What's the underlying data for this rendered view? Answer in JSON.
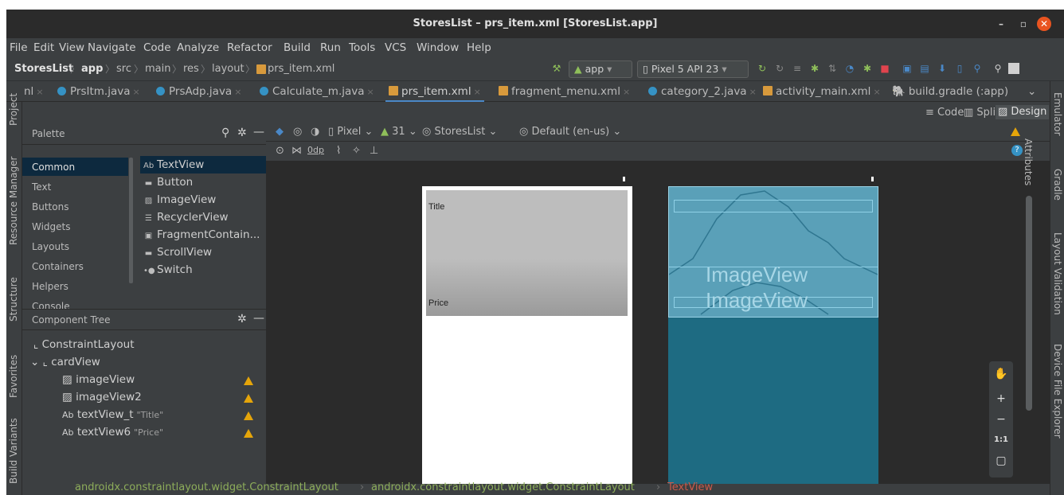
{
  "window": {
    "title": "StoresList – prs_item.xml [StoresList.app]",
    "min": "–",
    "restore": "▫",
    "close": "✕"
  },
  "menu": [
    "File",
    "Edit",
    "View",
    "Navigate",
    "Code",
    "Analyze",
    "Refactor",
    "Build",
    "Run",
    "Tools",
    "VCS",
    "Window",
    "Help"
  ],
  "breadcrumb": [
    "StoresList",
    "app",
    "src",
    "main",
    "res",
    "layout",
    "prs_item.xml"
  ],
  "toolbar": {
    "run_config": "app",
    "device": "Pixel 5 API 23"
  },
  "tabs": [
    {
      "label": "nl",
      "kind": "none"
    },
    {
      "label": "PrsItm.java",
      "kind": "class"
    },
    {
      "label": "PrsAdp.java",
      "kind": "class"
    },
    {
      "label": "Calculate_m.java",
      "kind": "class"
    },
    {
      "label": "prs_item.xml",
      "kind": "xml",
      "active": true
    },
    {
      "label": "fragment_menu.xml",
      "kind": "xml"
    },
    {
      "label": "category_2.java",
      "kind": "class"
    },
    {
      "label": "activity_main.xml",
      "kind": "xml"
    },
    {
      "label": "build.gradle (:app)",
      "kind": "gradle"
    }
  ],
  "view_modes": {
    "code": "Code",
    "split": "Split",
    "design": "Design"
  },
  "left_tools": {
    "project": "Project",
    "resource_manager": "Resource Manager",
    "structure": "Structure",
    "favorites": "Favorites",
    "build_variants": "Build Variants"
  },
  "right_tools": {
    "emulator": "Emulator",
    "gradle": "Gradle",
    "layout_validation": "Layout Validation",
    "device_file_explorer": "Device File Explorer"
  },
  "palette": {
    "title": "Palette",
    "categories": [
      "Common",
      "Text",
      "Buttons",
      "Widgets",
      "Layouts",
      "Containers",
      "Helpers",
      "Console"
    ],
    "items": [
      {
        "label": "TextView",
        "icon": "Ab"
      },
      {
        "label": "Button",
        "icon": "▬"
      },
      {
        "label": "ImageView",
        "icon": "▨"
      },
      {
        "label": "RecyclerView",
        "icon": "☰"
      },
      {
        "label": "FragmentContain...",
        "icon": "▣"
      },
      {
        "label": "ScrollView",
        "icon": "▬"
      },
      {
        "label": "Switch",
        "icon": "•●"
      }
    ]
  },
  "component_tree": {
    "title": "Component Tree",
    "rows": [
      {
        "label": "ConstraintLayout",
        "indent": 0,
        "icon": "⌞",
        "warn": false,
        "quote": ""
      },
      {
        "label": "cardView",
        "indent": 1,
        "icon": "⌞",
        "warn": false,
        "quote": ""
      },
      {
        "label": "imageView",
        "indent": 2,
        "icon": "▨",
        "warn": true,
        "quote": ""
      },
      {
        "label": "imageView2",
        "indent": 2,
        "icon": "▨",
        "warn": true,
        "quote": ""
      },
      {
        "label": "textView_t",
        "indent": 2,
        "icon": "Ab",
        "warn": true,
        "quote": "\"Title\""
      },
      {
        "label": "textView6",
        "indent": 2,
        "icon": "Ab",
        "warn": true,
        "quote": "\"Price\""
      }
    ]
  },
  "design_toolbar": {
    "device": "Pixel",
    "api": "31",
    "theme": "StoresList",
    "locale": "Default (en-us)",
    "margin": "0dp",
    "attributes": "Attributes"
  },
  "preview": {
    "title": "Title",
    "price": "Price",
    "image_label": "ImageView"
  },
  "status_path": [
    "androidx.constraintlayout.widget.ConstraintLayout",
    "androidx.constraintlayout.widget.ConstraintLayout",
    "TextView"
  ],
  "zoom": {
    "fit": "1:1",
    "plus": "+",
    "minus": "−"
  },
  "colors": {
    "accent": "#4a88c7",
    "warning": "#e5a50a",
    "blueprint": "#1e6b82",
    "selected": "#0d293e",
    "path_green": "#8dad5a"
  }
}
